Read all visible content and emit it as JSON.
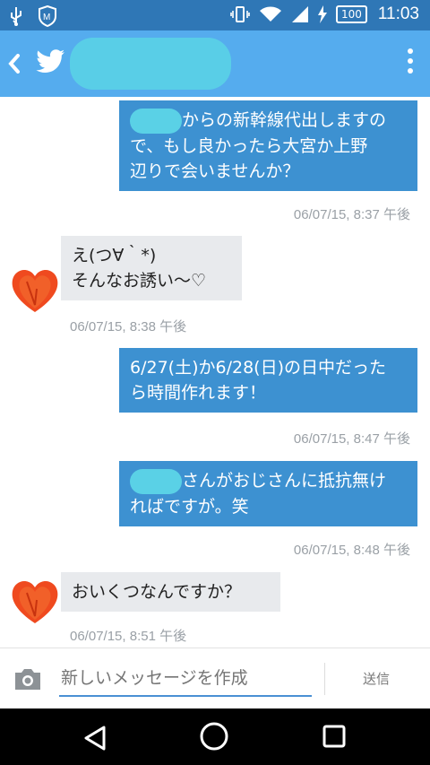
{
  "status_bar": {
    "battery": "100",
    "time": "11:03"
  },
  "messages": [
    {
      "direction": "outgoing",
      "lines": [
        "からの新幹線代出しますの",
        "で、もし良かったら大宮か上野",
        "辺りで会いませんか？"
      ],
      "meta": "06/07/15, 8:37 午後"
    },
    {
      "direction": "incoming",
      "lines": [
        "え(つ∀｀*)",
        "そんなお誘い〜♡"
      ],
      "meta": "06/07/15, 8:38 午後"
    },
    {
      "direction": "outgoing",
      "lines": [
        "6/27(土)か6/28(日)の日中だった",
        "ら時間作れます！"
      ],
      "meta": "06/07/15, 8:47 午後"
    },
    {
      "direction": "outgoing",
      "lines": [
        "さんがおじさんに抵抗無け",
        "ればですが。笑"
      ],
      "meta": "06/07/15, 8:48 午後"
    },
    {
      "direction": "incoming",
      "lines": [
        "おいくつなんですか？"
      ],
      "meta": "06/07/15, 8:51 午後"
    }
  ],
  "composer": {
    "placeholder": "新しいメッセージを作成",
    "send_label": "送信"
  },
  "colors": {
    "status_bar": "#2f77b6",
    "app_bar": "#55acee",
    "outgoing_bubble": "#3d91d1",
    "incoming_bubble": "#e8eaed"
  }
}
